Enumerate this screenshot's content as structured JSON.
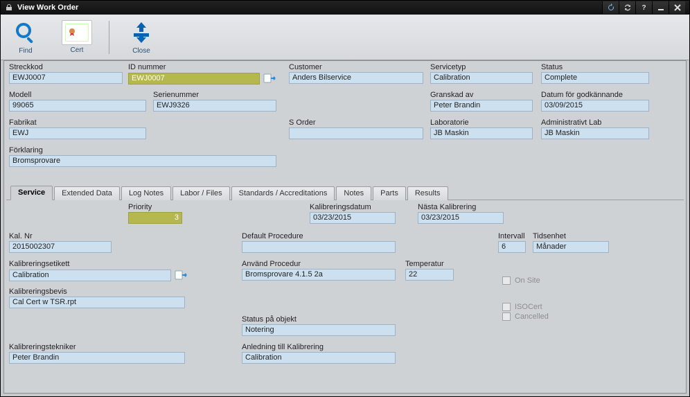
{
  "window": {
    "title": "View Work Order"
  },
  "toolbar": {
    "find": "Find",
    "cert": "Cert",
    "close": "Close"
  },
  "hdr": {
    "streckkod": {
      "label": "Streckkod",
      "value": "EWJ0007"
    },
    "id_nummer": {
      "label": "ID nummer",
      "value": "EWJ0007"
    },
    "customer": {
      "label": "Customer",
      "value": "Anders Bilservice"
    },
    "servicetyp": {
      "label": "Servicetyp",
      "value": "Calibration"
    },
    "status": {
      "label": "Status",
      "value": "Complete"
    },
    "modell": {
      "label": "Modell",
      "value": "99065"
    },
    "serienummer": {
      "label": "Serienummer",
      "value": "EWJ9326"
    },
    "granskad_av": {
      "label": "Granskad av",
      "value": "Peter Brandin"
    },
    "datum_godk": {
      "label": "Datum för godkännande",
      "value": "03/09/2015"
    },
    "fabrikat": {
      "label": "Fabrikat",
      "value": "EWJ"
    },
    "s_order": {
      "label": "S Order",
      "value": ""
    },
    "laboratorie": {
      "label": "Laboratorie",
      "value": "JB Maskin"
    },
    "admin_lab": {
      "label": "Administrativt Lab",
      "value": "JB Maskin"
    },
    "forklaring": {
      "label": "Förklaring",
      "value": "Bromsprovare"
    }
  },
  "tabs": {
    "service": "Service",
    "extended": "Extended Data",
    "log": "Log Notes",
    "labor": "Labor / Files",
    "std": "Standards / Accreditations",
    "notes": "Notes",
    "parts": "Parts",
    "results": "Results"
  },
  "svc": {
    "priority": {
      "label": "Priority",
      "value": "3"
    },
    "kal_datum": {
      "label": "Kalibreringsdatum",
      "value": "03/23/2015"
    },
    "nasta_kal": {
      "label": "Nästa Kalibrering",
      "value": "03/23/2015"
    },
    "kal_nr": {
      "label": "Kal. Nr",
      "value": "2015002307"
    },
    "default_proc": {
      "label": "Default Procedure",
      "value": ""
    },
    "intervall": {
      "label": "Intervall",
      "value": "6"
    },
    "tidsenhet": {
      "label": "Tidsenhet",
      "value": "Månader"
    },
    "kal_etikett": {
      "label": "Kalibreringsetikett",
      "value": "Calibration"
    },
    "anv_procedur": {
      "label": "Använd Procedur",
      "value": "Bromsprovare 4.1.5 2a"
    },
    "temperatur": {
      "label": "Temperatur",
      "value": "22"
    },
    "kal_bevis": {
      "label": "Kalibreringsbevis",
      "value": "Cal Cert w TSR.rpt"
    },
    "status_obj": {
      "label": "Status på objekt",
      "value": "Notering"
    },
    "anledning": {
      "label": "Anledning till Kalibrering",
      "value": "Calibration"
    },
    "kal_tekniker": {
      "label": "Kalibreringstekniker",
      "value": "Peter Brandin"
    },
    "on_site": "On Site",
    "isocert": "ISOCert",
    "cancelled": "Cancelled"
  }
}
